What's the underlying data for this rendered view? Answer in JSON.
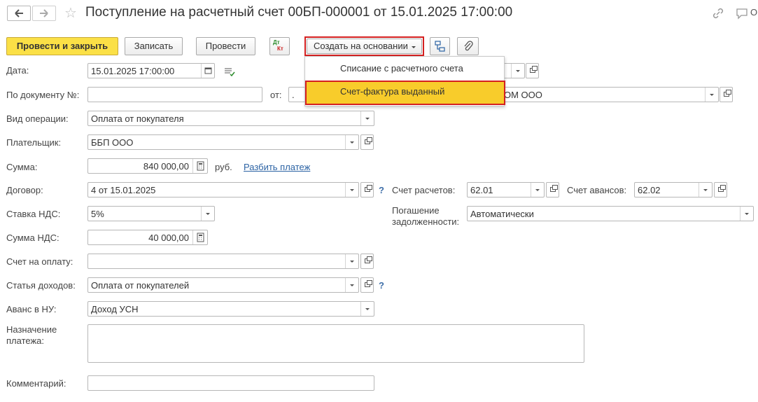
{
  "title": "Поступление на расчетный счет 00БП-000001 от 15.01.2025 17:00:00",
  "header_right_text": "О",
  "toolbar": {
    "post_close": "Провести и закрыть",
    "save": "Записать",
    "post": "Провести",
    "dtkt_top": "Дт",
    "dtkt_bottom": "Кт",
    "create_based": "Создать на основании"
  },
  "dropdown_menu": {
    "items": [
      "Списание с расчетного счета",
      "Счет-фактура выданный"
    ],
    "highlighted_index": 1
  },
  "form": {
    "date_label": "Дата:",
    "date_value": "15.01.2025 17:00:00",
    "doc_no_label": "По документу №:",
    "doc_no_value": "",
    "from_label": "от:",
    "from_value": ".",
    "org_value": "ОМ ООО",
    "op_type_label": "Вид операции:",
    "op_type_value": "Оплата от покупателя",
    "payer_label": "Плательщик:",
    "payer_value": "ББП ООО",
    "sum_label": "Сумма:",
    "sum_value": "840 000,00",
    "currency": "руб.",
    "split_link": "Разбить платеж",
    "contract_label": "Договор:",
    "contract_value": "4 от 15.01.2025",
    "settle_account_label": "Счет расчетов:",
    "settle_account_value": "62.01",
    "advance_account_label": "Счет авансов:",
    "advance_account_value": "62.02",
    "vat_rate_label": "Ставка НДС:",
    "vat_rate_value": "5%",
    "debt_label_1": "Погашение",
    "debt_label_2": "задолженности:",
    "debt_value": "Автоматически",
    "vat_sum_label": "Сумма НДС:",
    "vat_sum_value": "40 000,00",
    "invoice_label": "Счет на оплату:",
    "invoice_value": "",
    "income_item_label": "Статья доходов:",
    "income_item_value": "Оплата от покупателей",
    "advance_nu_label": "Аванс в НУ:",
    "advance_nu_value": "Доход УСН",
    "purpose_label_1": "Назначение",
    "purpose_label_2": "платежа:",
    "purpose_value": "",
    "comment_label": "Комментарий:",
    "comment_value": "",
    "help_mark": "?"
  },
  "colors": {
    "primary_button": "#fbe046",
    "menu_highlight": "#f8cc2b",
    "highlight_border": "#d42020",
    "link": "#2c63a4"
  }
}
